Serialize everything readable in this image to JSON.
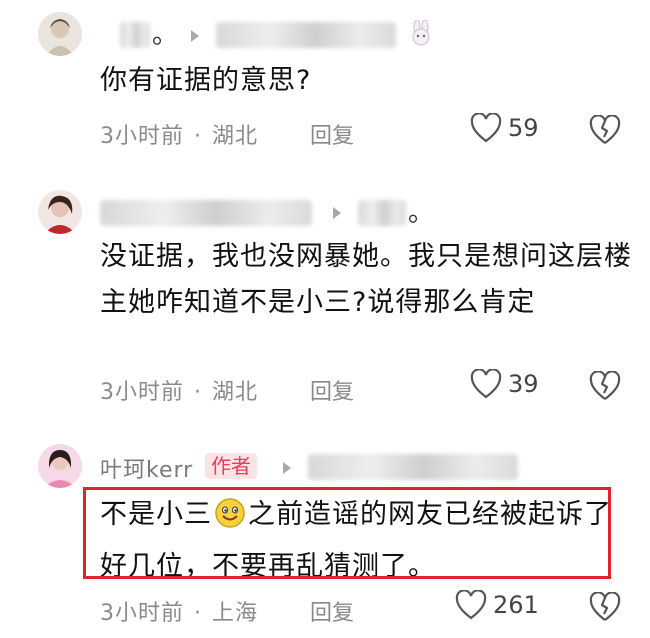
{
  "comments": [
    {
      "text": "你有证据的意思?",
      "time": "3小时前",
      "location": "湖北",
      "reply_label": "回复",
      "likes": "59",
      "avatar": "avatar-woman-icon"
    },
    {
      "text": "没证据，我也没网暴她。我只是想问这层楼主她咋知道不是小三?说得那么肯定",
      "time": "3小时前",
      "location": "湖北",
      "reply_label": "回复",
      "likes": "39",
      "avatar": "avatar-woman-red-icon"
    },
    {
      "author": "叶珂kerr",
      "author_badge": "作者",
      "text_before_emoji": "不是小三",
      "text_after_emoji": "之前造谣的网友已经被起诉了好几位，不要再乱猜测了。",
      "emoji": "smile-emoji-icon",
      "time": "3小时前",
      "location": "上海",
      "reply_label": "回复",
      "likes": "261",
      "avatar": "avatar-author-icon"
    }
  ],
  "colors": {
    "author_badge_bg": "#fde3e6",
    "author_badge_text": "#ee3b59",
    "highlight_border": "#e0242a",
    "meta_text": "#8a8a8a"
  }
}
